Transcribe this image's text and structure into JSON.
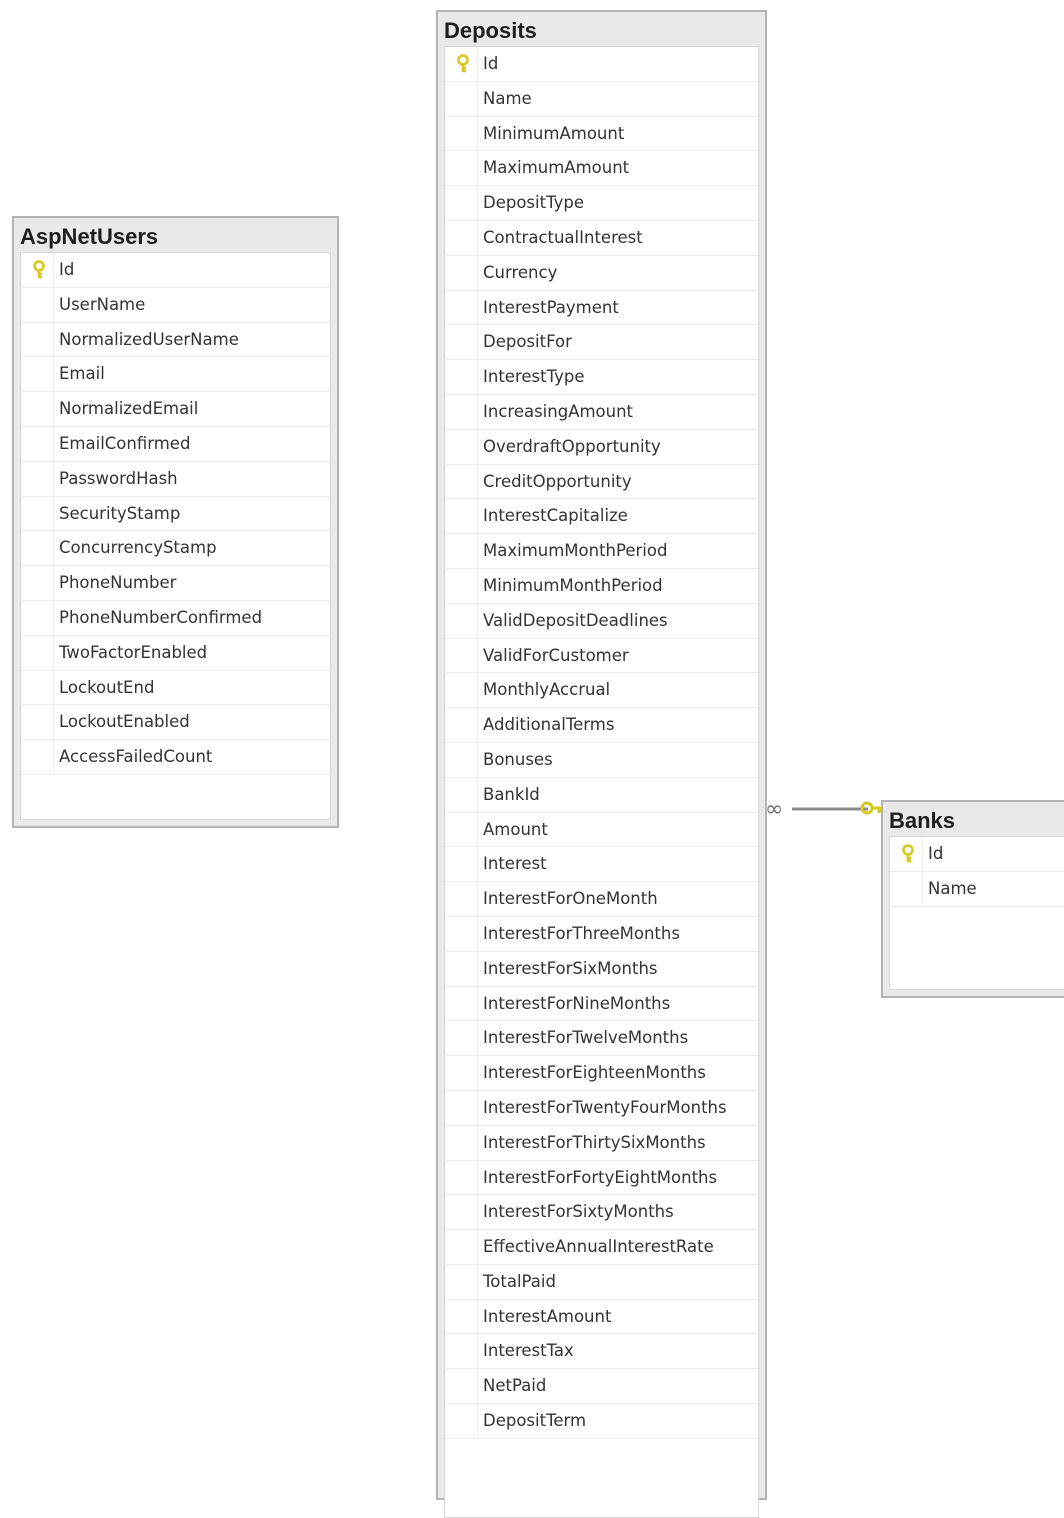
{
  "tables": {
    "aspnetusers": {
      "name": "AspNetUsers",
      "columns": [
        "Id",
        "UserName",
        "NormalizedUserName",
        "Email",
        "NormalizedEmail",
        "EmailConfirmed",
        "PasswordHash",
        "SecurityStamp",
        "ConcurrencyStamp",
        "PhoneNumber",
        "PhoneNumberConfirmed",
        "TwoFactorEnabled",
        "LockoutEnd",
        "LockoutEnabled",
        "AccessFailedCount"
      ],
      "primary_key": "Id"
    },
    "deposits": {
      "name": "Deposits",
      "columns": [
        "Id",
        "Name",
        "MinimumAmount",
        "MaximumAmount",
        "DepositType",
        "ContractualInterest",
        "Currency",
        "InterestPayment",
        "DepositFor",
        "InterestType",
        "IncreasingAmount",
        "OverdraftOpportunity",
        "CreditOpportunity",
        "InterestCapitalize",
        "MaximumMonthPeriod",
        "MinimumMonthPeriod",
        "ValidDepositDeadlines",
        "ValidForCustomer",
        "MonthlyAccrual",
        "AdditionalTerms",
        "Bonuses",
        "BankId",
        "Amount",
        "Interest",
        "InterestForOneMonth",
        "InterestForThreeMonths",
        "InterestForSixMonths",
        "InterestForNineMonths",
        "InterestForTwelveMonths",
        "InterestForEighteenMonths",
        "InterestForTwentyFourMonths",
        "InterestForThirtySixMonths",
        "InterestForFortyEightMonths",
        "InterestForSixtyMonths",
        "EffectiveAnnualInterestRate",
        "TotalPaid",
        "InterestAmount",
        "InterestTax",
        "NetPaid",
        "DepositTerm"
      ],
      "primary_key": "Id"
    },
    "banks": {
      "name": "Banks",
      "columns": [
        "Id",
        "Name"
      ],
      "primary_key": "Id"
    }
  },
  "relationships": [
    {
      "from": "deposits",
      "from_end": "many",
      "to": "banks",
      "to_end": "one"
    }
  ],
  "colors": {
    "key_icon": "#d8c81c",
    "relationship_line": "#8c8c8c",
    "relationship_key": "#d8c81c"
  },
  "icons": {
    "primary_key": "key-icon",
    "many_end": "infinity-icon"
  }
}
